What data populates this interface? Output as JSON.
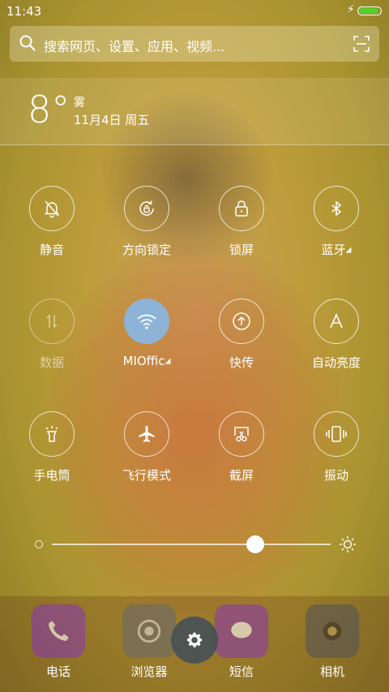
{
  "status_bar": {
    "time": "11:43",
    "battery_level": 0.95,
    "charging": true
  },
  "search": {
    "placeholder": "搜索网页、设置、应用、视频..."
  },
  "weather": {
    "temperature": "8°",
    "condition": "雾",
    "date": "11月4日 周五"
  },
  "toggles": [
    {
      "label": "静音",
      "icon": "bell-off-icon",
      "state": "off"
    },
    {
      "label": "方向锁定",
      "icon": "rotation-lock-icon",
      "state": "off"
    },
    {
      "label": "锁屏",
      "icon": "lock-icon",
      "state": "off"
    },
    {
      "label": "蓝牙",
      "icon": "bluetooth-icon",
      "state": "off",
      "has_more": true
    },
    {
      "label": "数据",
      "icon": "mobile-data-icon",
      "state": "disabled"
    },
    {
      "label": "MIOffic",
      "icon": "wifi-icon",
      "state": "on",
      "has_more": true
    },
    {
      "label": "快传",
      "icon": "quick-transfer-icon",
      "state": "off"
    },
    {
      "label": "自动亮度",
      "icon": "auto-brightness-icon",
      "state": "off"
    },
    {
      "label": "手电筒",
      "icon": "flashlight-icon",
      "state": "off"
    },
    {
      "label": "飞行模式",
      "icon": "airplane-icon",
      "state": "off"
    },
    {
      "label": "截屏",
      "icon": "screenshot-icon",
      "state": "off"
    },
    {
      "label": "振动",
      "icon": "vibrate-icon",
      "state": "off"
    }
  ],
  "brightness": {
    "level": 0.73
  },
  "dock": [
    {
      "label": "电话",
      "icon": "phone-icon",
      "color": "#8a3aa8"
    },
    {
      "label": "浏览器",
      "icon": "browser-icon",
      "color": "#6b6b6b"
    },
    {
      "label": "短信",
      "icon": "message-icon",
      "color": "#8a3aa8"
    },
    {
      "label": "相机",
      "icon": "camera-icon",
      "color": "#555555"
    }
  ],
  "colors": {
    "wifi_active": "#8db4d6",
    "battery": "#55d12a"
  }
}
